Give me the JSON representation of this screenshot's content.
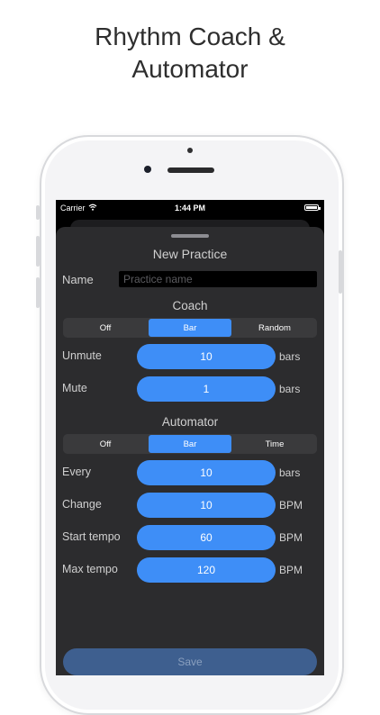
{
  "headline": {
    "line1": "Rhythm Coach &",
    "line2": "Automator"
  },
  "status_bar": {
    "carrier": "Carrier",
    "time": "1:44 PM"
  },
  "sheet": {
    "title": "New Practice",
    "name_label": "Name",
    "name_placeholder": "Practice name",
    "name_value": ""
  },
  "coach": {
    "title": "Coach",
    "segments": [
      "Off",
      "Bar",
      "Random"
    ],
    "selected": "Bar",
    "rows": [
      {
        "label": "Unmute",
        "value": "10",
        "unit": "bars"
      },
      {
        "label": "Mute",
        "value": "1",
        "unit": "bars"
      }
    ]
  },
  "automator": {
    "title": "Automator",
    "segments": [
      "Off",
      "Bar",
      "Time"
    ],
    "selected": "Bar",
    "rows": [
      {
        "label": "Every",
        "value": "10",
        "unit": "bars"
      },
      {
        "label": "Change",
        "value": "10",
        "unit": "BPM"
      },
      {
        "label": "Start tempo",
        "value": "60",
        "unit": "BPM"
      },
      {
        "label": "Max tempo",
        "value": "120",
        "unit": "BPM"
      }
    ]
  },
  "save_label": "Save",
  "colors": {
    "accent": "#3e8ef7",
    "sheet_bg": "#2c2c2e",
    "segment_bg": "#3a3a3c"
  }
}
